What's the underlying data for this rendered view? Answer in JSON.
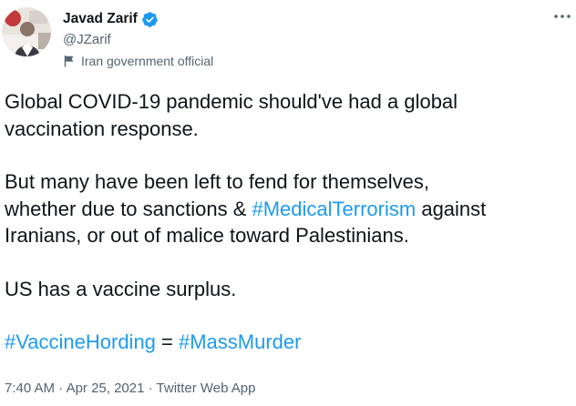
{
  "author": {
    "display_name": "Javad Zarif",
    "handle": "@JZarif",
    "label": "Iran government official",
    "verified": true,
    "verified_color": "#1d9bf0"
  },
  "menu": {
    "icon": "more-horizontal-icon"
  },
  "tweet": {
    "line1": "Global COVID-19 pandemic should've had a global",
    "line2": "vaccination response.",
    "p2_line1": "But many have been left to fend for themselves,",
    "p2_line2_a": "whether due to sanctions & ",
    "p2_hashtag": "#MedicalTerrorism",
    "p2_line2_b": " against",
    "p2_line3": "Iranians, or out of malice toward Palestinians.",
    "p3": "US has a vaccine surplus.",
    "p4_hashtag1": "#VaccineHording",
    "p4_eq": " = ",
    "p4_hashtag2": "#MassMurder",
    "hashtag_color": "#1d9bf0"
  },
  "meta": {
    "time": "7:40 AM",
    "sep1": " · ",
    "date": "Apr 25, 2021",
    "sep2": " · ",
    "source": "Twitter Web App"
  }
}
